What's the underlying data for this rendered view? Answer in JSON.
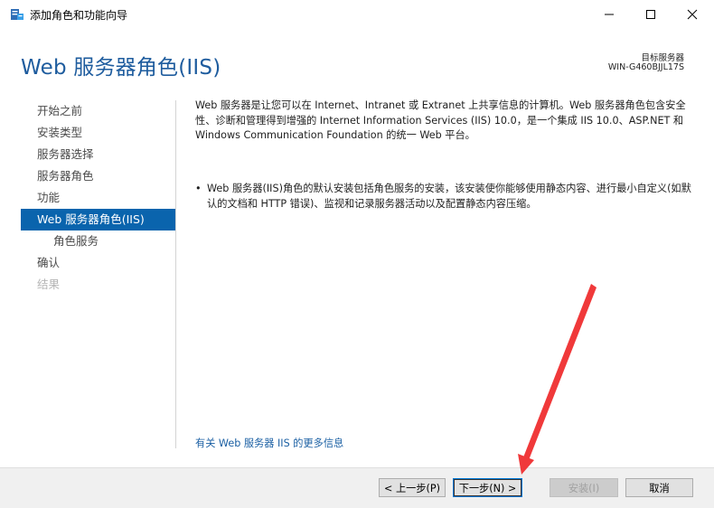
{
  "window": {
    "title": "添加角色和功能向导",
    "icon": "server-manager-icon",
    "controls": [
      "minimize-icon",
      "maximize-icon",
      "close-icon"
    ]
  },
  "header": {
    "title": "Web 服务器角色(IIS)",
    "target_label": "目标服务器",
    "target_name": "WIN-G460BJJL17S"
  },
  "nav": {
    "items": [
      {
        "label": "开始之前",
        "state": "normal"
      },
      {
        "label": "安装类型",
        "state": "normal"
      },
      {
        "label": "服务器选择",
        "state": "normal"
      },
      {
        "label": "服务器角色",
        "state": "normal"
      },
      {
        "label": "功能",
        "state": "normal"
      },
      {
        "label": "Web 服务器角色(IIS)",
        "state": "active"
      },
      {
        "label": "角色服务",
        "state": "sub"
      },
      {
        "label": "确认",
        "state": "normal"
      },
      {
        "label": "结果",
        "state": "disabled"
      }
    ]
  },
  "content": {
    "intro": "Web 服务器是让您可以在 Internet、Intranet 或 Extranet 上共享信息的计算机。Web 服务器角色包含安全性、诊断和管理得到增强的 Internet Information Services (IIS) 10.0，是一个集成 IIS 10.0、ASP.NET 和 Windows Communication Foundation 的统一 Web 平台。",
    "bullet_symbol": "•",
    "bullet": "Web 服务器(IIS)角色的默认安装包括角色服务的安装，该安装使你能够使用静态内容、进行最小自定义(如默认的文档和 HTTP 错误)、监视和记录服务器活动以及配置静态内容压缩。",
    "more_link": "有关 Web 服务器 IIS 的更多信息"
  },
  "footer": {
    "prev_label": "< 上一步(P)",
    "next_label": "下一步(N) >",
    "install_label": "安装(I)",
    "cancel_label": "取消"
  },
  "colors": {
    "title_blue": "#1e5c9e",
    "nav_active_bg": "#0a64ad",
    "link_blue": "#1a5fa3",
    "annotation_arrow": "#f0393a"
  }
}
